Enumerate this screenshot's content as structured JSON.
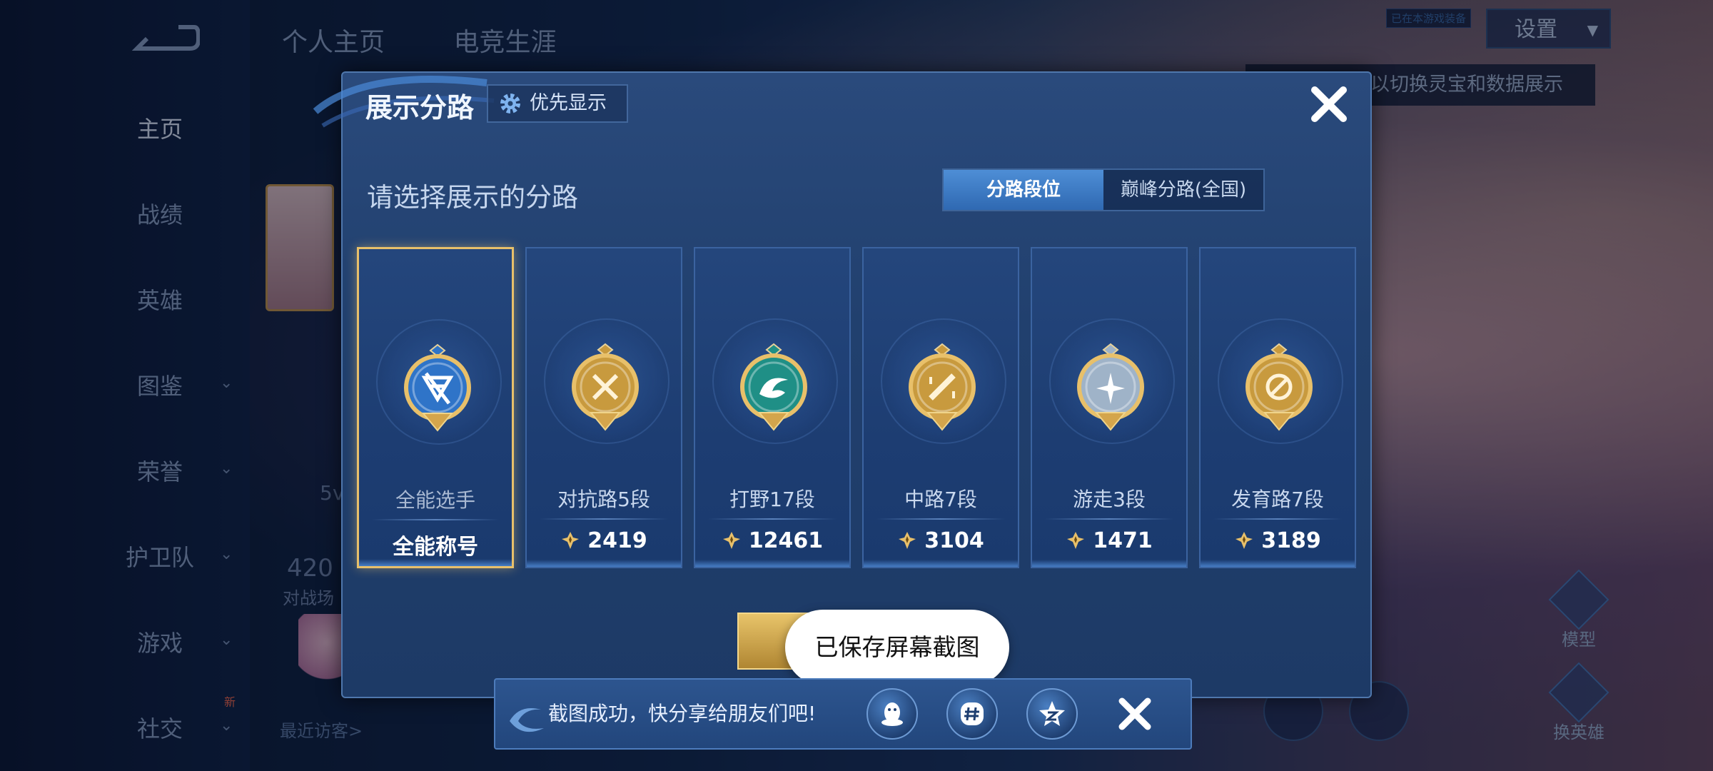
{
  "background": {
    "nav": {
      "items": [
        {
          "label": "主页",
          "active": true,
          "has_chevron": false
        },
        {
          "label": "战绩",
          "active": false,
          "has_chevron": false
        },
        {
          "label": "英雄",
          "active": false,
          "has_chevron": false
        },
        {
          "label": "图鉴",
          "active": false,
          "has_chevron": true
        },
        {
          "label": "荣誉",
          "active": false,
          "has_chevron": true
        },
        {
          "label": "护卫队",
          "active": false,
          "has_chevron": true
        },
        {
          "label": "游戏",
          "active": false,
          "has_chevron": true
        },
        {
          "label": "社交",
          "active": false,
          "has_chevron": true
        }
      ],
      "new_badge": "新"
    },
    "top_tabs": [
      "个人主页",
      "电竞生涯"
    ],
    "settings_label": "设置",
    "tip_badge": "已在本游戏装备",
    "hint_text": "以切换灵宝和数据展示",
    "peek_count": "420",
    "peek_sub": "对战场",
    "peek_5v": "5v",
    "visitor_label": "最近访客>",
    "right_buttons": [
      {
        "label": "模型"
      },
      {
        "label": "换英雄"
      }
    ]
  },
  "dialog": {
    "title": "展示分路",
    "priority_button": "优先显示",
    "subtitle": "请选择展示的分路",
    "toggle": {
      "options": [
        "分路段位",
        "巅峰分路(全国)"
      ],
      "selected": 0
    },
    "cards": [
      {
        "lane": "全能选手",
        "value": "全能称号",
        "emblem": "all-round-emblem",
        "selected": true,
        "show_points_icon": false,
        "color": "#2f74c8"
      },
      {
        "lane": "对抗路5段",
        "value": "2419",
        "emblem": "clash-lane-emblem",
        "selected": false,
        "show_points_icon": true,
        "color": "#c89a3e"
      },
      {
        "lane": "打野17段",
        "value": "12461",
        "emblem": "jungle-emblem",
        "selected": false,
        "show_points_icon": true,
        "color": "#1f8f86"
      },
      {
        "lane": "中路7段",
        "value": "3104",
        "emblem": "mid-lane-emblem",
        "selected": false,
        "show_points_icon": true,
        "color": "#c89a3e"
      },
      {
        "lane": "游走3段",
        "value": "1471",
        "emblem": "roam-emblem",
        "selected": false,
        "show_points_icon": true,
        "color": "#9fb3c8"
      },
      {
        "lane": "发育路7段",
        "value": "3189",
        "emblem": "farm-lane-emblem",
        "selected": false,
        "show_points_icon": true,
        "color": "#c89a3e"
      }
    ]
  },
  "toast": "已保存屏幕截图",
  "share_bar": {
    "text": "截图成功，快分享给朋友们吧!",
    "icons": [
      "qq-icon",
      "wechat-moments-icon",
      "qzone-icon"
    ]
  },
  "colors": {
    "gold": "#e8c06a",
    "accent_blue": "#3a7ac8",
    "dialog_bg": "#21406e"
  }
}
